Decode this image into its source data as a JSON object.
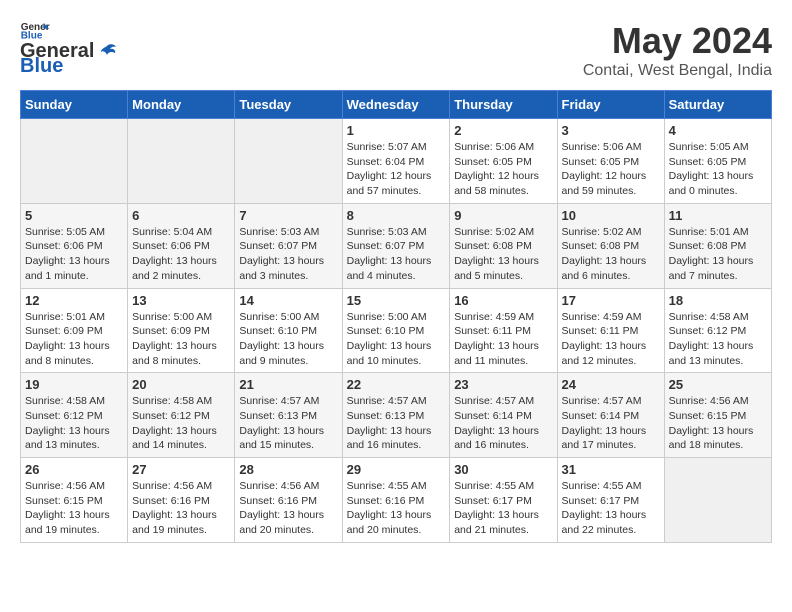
{
  "header": {
    "logo_general": "General",
    "logo_blue": "Blue",
    "month": "May 2024",
    "location": "Contai, West Bengal, India"
  },
  "days_of_week": [
    "Sunday",
    "Monday",
    "Tuesday",
    "Wednesday",
    "Thursday",
    "Friday",
    "Saturday"
  ],
  "weeks": [
    [
      {
        "day": "",
        "info": ""
      },
      {
        "day": "",
        "info": ""
      },
      {
        "day": "",
        "info": ""
      },
      {
        "day": "1",
        "sunrise": "Sunrise: 5:07 AM",
        "sunset": "Sunset: 6:04 PM",
        "daylight": "Daylight: 12 hours and 57 minutes."
      },
      {
        "day": "2",
        "sunrise": "Sunrise: 5:06 AM",
        "sunset": "Sunset: 6:05 PM",
        "daylight": "Daylight: 12 hours and 58 minutes."
      },
      {
        "day": "3",
        "sunrise": "Sunrise: 5:06 AM",
        "sunset": "Sunset: 6:05 PM",
        "daylight": "Daylight: 12 hours and 59 minutes."
      },
      {
        "day": "4",
        "sunrise": "Sunrise: 5:05 AM",
        "sunset": "Sunset: 6:05 PM",
        "daylight": "Daylight: 13 hours and 0 minutes."
      }
    ],
    [
      {
        "day": "5",
        "sunrise": "Sunrise: 5:05 AM",
        "sunset": "Sunset: 6:06 PM",
        "daylight": "Daylight: 13 hours and 1 minute."
      },
      {
        "day": "6",
        "sunrise": "Sunrise: 5:04 AM",
        "sunset": "Sunset: 6:06 PM",
        "daylight": "Daylight: 13 hours and 2 minutes."
      },
      {
        "day": "7",
        "sunrise": "Sunrise: 5:03 AM",
        "sunset": "Sunset: 6:07 PM",
        "daylight": "Daylight: 13 hours and 3 minutes."
      },
      {
        "day": "8",
        "sunrise": "Sunrise: 5:03 AM",
        "sunset": "Sunset: 6:07 PM",
        "daylight": "Daylight: 13 hours and 4 minutes."
      },
      {
        "day": "9",
        "sunrise": "Sunrise: 5:02 AM",
        "sunset": "Sunset: 6:08 PM",
        "daylight": "Daylight: 13 hours and 5 minutes."
      },
      {
        "day": "10",
        "sunrise": "Sunrise: 5:02 AM",
        "sunset": "Sunset: 6:08 PM",
        "daylight": "Daylight: 13 hours and 6 minutes."
      },
      {
        "day": "11",
        "sunrise": "Sunrise: 5:01 AM",
        "sunset": "Sunset: 6:08 PM",
        "daylight": "Daylight: 13 hours and 7 minutes."
      }
    ],
    [
      {
        "day": "12",
        "sunrise": "Sunrise: 5:01 AM",
        "sunset": "Sunset: 6:09 PM",
        "daylight": "Daylight: 13 hours and 8 minutes."
      },
      {
        "day": "13",
        "sunrise": "Sunrise: 5:00 AM",
        "sunset": "Sunset: 6:09 PM",
        "daylight": "Daylight: 13 hours and 8 minutes."
      },
      {
        "day": "14",
        "sunrise": "Sunrise: 5:00 AM",
        "sunset": "Sunset: 6:10 PM",
        "daylight": "Daylight: 13 hours and 9 minutes."
      },
      {
        "day": "15",
        "sunrise": "Sunrise: 5:00 AM",
        "sunset": "Sunset: 6:10 PM",
        "daylight": "Daylight: 13 hours and 10 minutes."
      },
      {
        "day": "16",
        "sunrise": "Sunrise: 4:59 AM",
        "sunset": "Sunset: 6:11 PM",
        "daylight": "Daylight: 13 hours and 11 minutes."
      },
      {
        "day": "17",
        "sunrise": "Sunrise: 4:59 AM",
        "sunset": "Sunset: 6:11 PM",
        "daylight": "Daylight: 13 hours and 12 minutes."
      },
      {
        "day": "18",
        "sunrise": "Sunrise: 4:58 AM",
        "sunset": "Sunset: 6:12 PM",
        "daylight": "Daylight: 13 hours and 13 minutes."
      }
    ],
    [
      {
        "day": "19",
        "sunrise": "Sunrise: 4:58 AM",
        "sunset": "Sunset: 6:12 PM",
        "daylight": "Daylight: 13 hours and 13 minutes."
      },
      {
        "day": "20",
        "sunrise": "Sunrise: 4:58 AM",
        "sunset": "Sunset: 6:12 PM",
        "daylight": "Daylight: 13 hours and 14 minutes."
      },
      {
        "day": "21",
        "sunrise": "Sunrise: 4:57 AM",
        "sunset": "Sunset: 6:13 PM",
        "daylight": "Daylight: 13 hours and 15 minutes."
      },
      {
        "day": "22",
        "sunrise": "Sunrise: 4:57 AM",
        "sunset": "Sunset: 6:13 PM",
        "daylight": "Daylight: 13 hours and 16 minutes."
      },
      {
        "day": "23",
        "sunrise": "Sunrise: 4:57 AM",
        "sunset": "Sunset: 6:14 PM",
        "daylight": "Daylight: 13 hours and 16 minutes."
      },
      {
        "day": "24",
        "sunrise": "Sunrise: 4:57 AM",
        "sunset": "Sunset: 6:14 PM",
        "daylight": "Daylight: 13 hours and 17 minutes."
      },
      {
        "day": "25",
        "sunrise": "Sunrise: 4:56 AM",
        "sunset": "Sunset: 6:15 PM",
        "daylight": "Daylight: 13 hours and 18 minutes."
      }
    ],
    [
      {
        "day": "26",
        "sunrise": "Sunrise: 4:56 AM",
        "sunset": "Sunset: 6:15 PM",
        "daylight": "Daylight: 13 hours and 19 minutes."
      },
      {
        "day": "27",
        "sunrise": "Sunrise: 4:56 AM",
        "sunset": "Sunset: 6:16 PM",
        "daylight": "Daylight: 13 hours and 19 minutes."
      },
      {
        "day": "28",
        "sunrise": "Sunrise: 4:56 AM",
        "sunset": "Sunset: 6:16 PM",
        "daylight": "Daylight: 13 hours and 20 minutes."
      },
      {
        "day": "29",
        "sunrise": "Sunrise: 4:55 AM",
        "sunset": "Sunset: 6:16 PM",
        "daylight": "Daylight: 13 hours and 20 minutes."
      },
      {
        "day": "30",
        "sunrise": "Sunrise: 4:55 AM",
        "sunset": "Sunset: 6:17 PM",
        "daylight": "Daylight: 13 hours and 21 minutes."
      },
      {
        "day": "31",
        "sunrise": "Sunrise: 4:55 AM",
        "sunset": "Sunset: 6:17 PM",
        "daylight": "Daylight: 13 hours and 22 minutes."
      },
      {
        "day": "",
        "info": ""
      }
    ]
  ]
}
